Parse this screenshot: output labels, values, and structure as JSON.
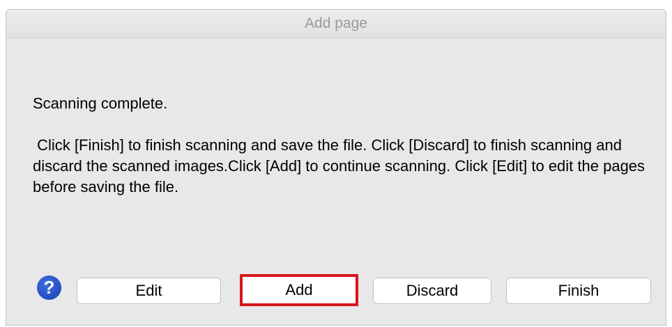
{
  "window": {
    "title": "Add page"
  },
  "message": {
    "line1": "Scanning complete.",
    "line2": " Click [Finish] to finish scanning and save the file. Click [Discard] to finish scanning and discard the scanned images.Click [Add] to continue scanning. Click [Edit] to edit the pages before saving the file."
  },
  "buttons": {
    "help_symbol": "?",
    "help_icon": "question-mark-icon",
    "edit_label": "Edit",
    "add_label": "Add",
    "discard_label": "Discard",
    "finish_label": "Finish"
  },
  "colors": {
    "highlight": "#d9141c",
    "help_blue": "#1a3fb5"
  }
}
